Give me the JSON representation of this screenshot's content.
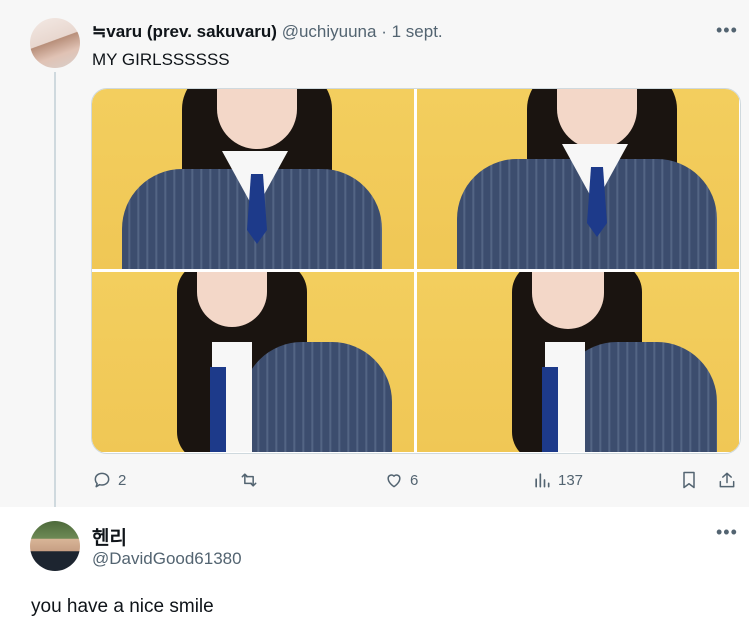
{
  "tweet": {
    "author_name": "≒varu (prev. sakuvaru)",
    "handle": "@uchiyuuna",
    "separator": "·",
    "date": "1 sept.",
    "text": "MY GIRLSSSSSS",
    "media_count": 4,
    "actions": {
      "replies": "2",
      "likes": "6",
      "views": "137"
    }
  },
  "reply": {
    "author_name": "헨리",
    "handle": "@DavidGood61380",
    "text": "you have a nice  smile"
  },
  "icons": {
    "more": "more-horizontal-icon",
    "reply": "speech-bubble-icon",
    "retweet": "retweet-arrows-icon",
    "like": "heart-icon",
    "views": "bar-chart-icon",
    "bookmark": "bookmark-icon",
    "share": "share-upload-icon"
  },
  "colors": {
    "muted": "#536471",
    "thread_line": "#cfd9de",
    "link": "#1d9bf0",
    "photo_background": "#f2c85a"
  }
}
